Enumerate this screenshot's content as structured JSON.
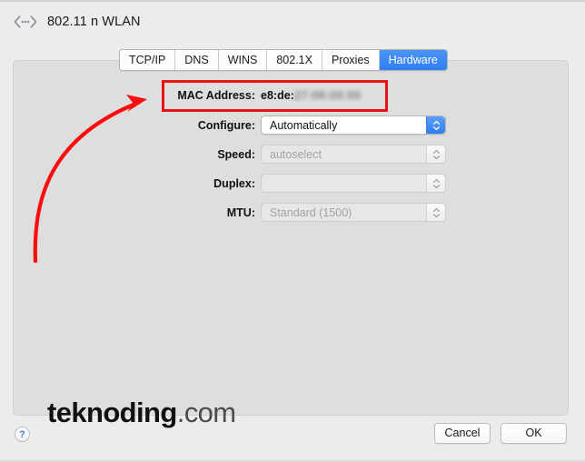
{
  "window": {
    "title": "802.11 n WLAN",
    "icon": "wlan-chevrons-icon"
  },
  "tabs": [
    {
      "label": "TCP/IP",
      "selected": false
    },
    {
      "label": "DNS",
      "selected": false
    },
    {
      "label": "WINS",
      "selected": false
    },
    {
      "label": "802.1X",
      "selected": false
    },
    {
      "label": "Proxies",
      "selected": false
    },
    {
      "label": "Hardware",
      "selected": true
    }
  ],
  "hardware": {
    "mac": {
      "label": "MAC Address:",
      "value_visible": "e8:de:",
      "value_redacted": "27:08:00:00"
    },
    "configure": {
      "label": "Configure:",
      "value": "Automatically",
      "enabled": true
    },
    "speed": {
      "label": "Speed:",
      "value": "autoselect",
      "enabled": false
    },
    "duplex": {
      "label": "Duplex:",
      "value": "",
      "enabled": false
    },
    "mtu": {
      "label": "MTU:",
      "value": "Standard  (1500)",
      "enabled": false
    }
  },
  "annotation": {
    "highlight_color": "#ee1111",
    "arrow_color": "#fc0d0d"
  },
  "watermark": {
    "bold": "teknoding",
    "light": ".com"
  },
  "footer": {
    "help_label": "?",
    "cancel_label": "Cancel",
    "ok_label": "OK"
  },
  "colors": {
    "window_bg": "#ececec",
    "panel_bg": "#dededf",
    "accent_blue": "#2f7df2"
  }
}
